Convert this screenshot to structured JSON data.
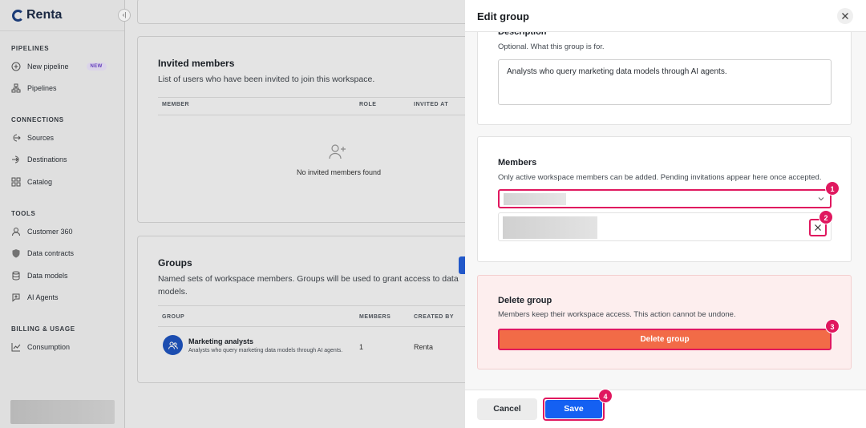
{
  "sidebar": {
    "logo": "Renta",
    "collapse_glyph": "‹|",
    "sections": {
      "pipelines": "PIPELINES",
      "connections": "CONNECTIONS",
      "tools": "TOOLS",
      "billing": "BILLING & USAGE"
    },
    "items": {
      "new_pipeline": "New pipeline",
      "new_badge": "NEW",
      "pipelines": "Pipelines",
      "sources": "Sources",
      "destinations": "Destinations",
      "catalog": "Catalog",
      "customer360": "Customer 360",
      "data_contracts": "Data contracts",
      "data_models": "Data models",
      "ai_agents": "AI Agents",
      "consumption": "Consumption"
    }
  },
  "main": {
    "invited": {
      "title": "Invited members",
      "subtitle": "List of users who have been invited to join this workspace.",
      "columns": [
        "MEMBER",
        "ROLE",
        "INVITED AT"
      ],
      "empty_text": "No invited members found"
    },
    "groups": {
      "title": "Groups",
      "subtitle": "Named sets of workspace members. Groups will be used to grant access to data models.",
      "columns": [
        "GROUP",
        "MEMBERS",
        "CREATED BY"
      ],
      "rows": [
        {
          "name": "Marketing analysts",
          "description": "Analysts who query marketing data models through AI agents.",
          "members": "1",
          "created_by": "Renta"
        }
      ]
    }
  },
  "drawer": {
    "title": "Edit group",
    "description_section": {
      "title": "Description",
      "subtitle": "Optional. What this group is for.",
      "value": "Analysts who query marketing data models through AI agents."
    },
    "members_section": {
      "title": "Members",
      "subtitle": "Only active workspace members can be added. Pending invitations appear here once accepted."
    },
    "delete_section": {
      "title": "Delete group",
      "subtitle": "Members keep their workspace access. This action cannot be undone.",
      "button": "Delete group"
    },
    "footer": {
      "cancel": "Cancel",
      "save": "Save"
    }
  },
  "markers": [
    "1",
    "2",
    "3",
    "4"
  ],
  "colors": {
    "accent_blue": "#1460f2",
    "highlight_pink": "#e0185f",
    "danger_orange": "#f26b47",
    "danger_bg": "#fdeeee"
  }
}
